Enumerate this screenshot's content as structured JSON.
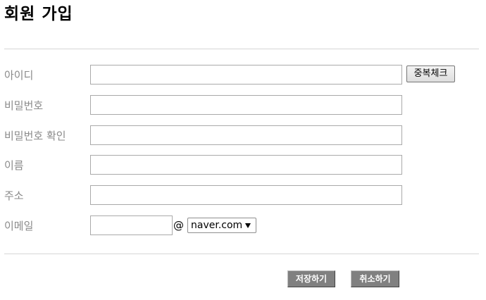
{
  "page": {
    "title": "회원 가입"
  },
  "form": {
    "id": {
      "label": "아이디",
      "value": "",
      "dup_check_label": "중복체크"
    },
    "password": {
      "label": "비밀번호",
      "value": ""
    },
    "password_confirm": {
      "label": "비밀번호 확인",
      "value": ""
    },
    "name": {
      "label": "이름",
      "value": ""
    },
    "address": {
      "label": "주소",
      "value": ""
    },
    "email": {
      "label": "이메일",
      "local_value": "",
      "at": "@",
      "domain_selected": "naver.com"
    }
  },
  "actions": {
    "save_label": "저장하기",
    "cancel_label": "취소하기"
  },
  "colors": {
    "label_text": "#8a8a8a",
    "divider": "#d6d6d6",
    "action_button_bg": "#808080",
    "action_button_text": "#ffffff"
  }
}
